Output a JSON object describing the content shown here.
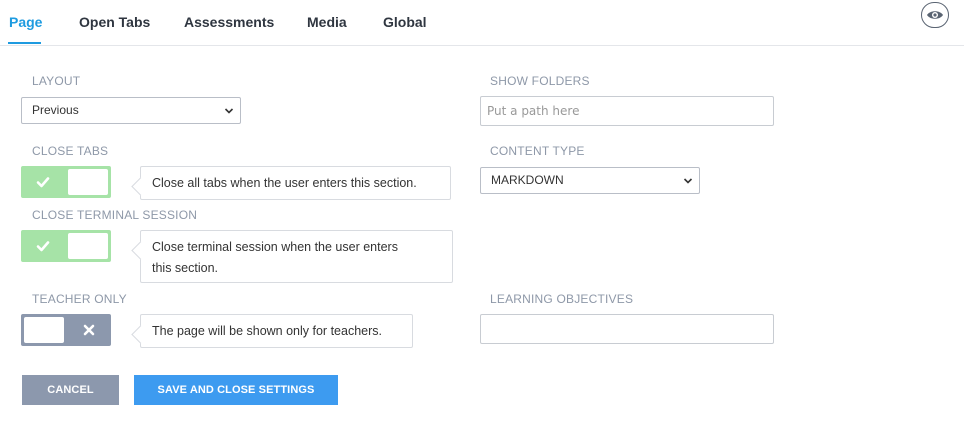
{
  "tabs": [
    {
      "label": "Page"
    },
    {
      "label": "Open Tabs"
    },
    {
      "label": "Assessments"
    },
    {
      "label": "Media"
    },
    {
      "label": "Global"
    }
  ],
  "active_tab": "Page",
  "layout": {
    "label": "LAYOUT",
    "value": "Previous"
  },
  "show_folders": {
    "label": "SHOW FOLDERS",
    "placeholder": "Put a path here",
    "value": ""
  },
  "close_tabs": {
    "label": "CLOSE TABS",
    "enabled": true,
    "help": "Close all tabs when the user enters this section."
  },
  "content_type": {
    "label": "CONTENT TYPE",
    "value": "MARKDOWN"
  },
  "close_terminal": {
    "label": "CLOSE TERMINAL SESSION",
    "enabled": true,
    "help_line1": "Close terminal session when the user enters",
    "help_line2": "this section."
  },
  "teacher_only": {
    "label": "TEACHER ONLY",
    "enabled": false,
    "help": "The page will be shown only for teachers."
  },
  "learning_objectives": {
    "label": "LEARNING OBJECTIVES",
    "value": ""
  },
  "buttons": {
    "cancel": "CANCEL",
    "save": "SAVE AND CLOSE SETTINGS"
  },
  "colors": {
    "accent": "#1e9be0",
    "toggle_on": "#a6e3a7",
    "toggle_off": "#8c98ad",
    "save": "#3d9bf0",
    "cancel": "#8c98ad"
  }
}
